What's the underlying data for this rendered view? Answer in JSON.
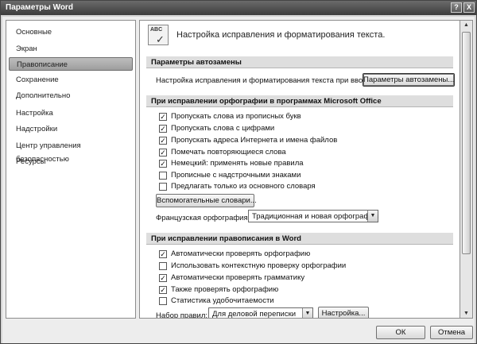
{
  "window": {
    "title": "Параметры Word",
    "help_label": "?",
    "close_label": "X"
  },
  "sidebar": {
    "items": [
      {
        "label": "Основные"
      },
      {
        "label": "Экран"
      },
      {
        "label": "Правописание",
        "selected": true
      },
      {
        "label": "Сохранение"
      },
      {
        "label": "Дополнительно"
      },
      {
        "label": "Настройка"
      },
      {
        "label": "Надстройки"
      },
      {
        "label": "Центр управления безопасностью"
      },
      {
        "label": "Ресурсы"
      }
    ]
  },
  "main": {
    "header_icon_text": "ABC",
    "header_icon_check": "✓",
    "header_title": "Настройка исправления и форматирования текста.",
    "autocorrect": {
      "section_title": "Параметры автозамены",
      "description": "Настройка исправления и форматирования текста при вводе:",
      "button_label": "Параметры автозамены..."
    },
    "office_spelling": {
      "section_title": "При исправлении орфографии в программах Microsoft Office",
      "checkboxes": [
        {
          "label": "Пропускать слова из прописных букв",
          "checked": true
        },
        {
          "label": "Пропускать слова с цифрами",
          "checked": true
        },
        {
          "label": "Пропускать адреса Интернета и имена файлов",
          "checked": true
        },
        {
          "label": "Помечать повторяющиеся слова",
          "checked": true
        },
        {
          "label": "Немецкий: применять новые правила",
          "checked": true
        },
        {
          "label": "Прописные с надстрочными знаками",
          "checked": false
        },
        {
          "label": "Предлагать только из основного словаря",
          "checked": false
        }
      ],
      "dictionaries_button": "Вспомогательные словари...",
      "french_label": "Французская орфография:",
      "french_value": "Традиционная и новая орфография"
    },
    "word_spelling": {
      "section_title": "При исправлении правописания в Word",
      "checkboxes": [
        {
          "label": "Автоматически проверять орфографию",
          "checked": true
        },
        {
          "label": "Использовать контекстную проверку орфографии",
          "checked": false
        },
        {
          "label": "Автоматически проверять грамматику",
          "checked": true
        },
        {
          "label": "Также проверять орфографию",
          "checked": true
        },
        {
          "label": "Статистика удобочитаемости",
          "checked": false
        }
      ],
      "ruleset_label": "Набор правил:",
      "ruleset_value": "Для деловой переписки",
      "settings_button": "Настройка..."
    }
  },
  "footer": {
    "ok_label": "ОК",
    "cancel_label": "Отмена"
  },
  "icons": {
    "dropdown_arrow": "▼",
    "scroll_up": "▲",
    "scroll_down": "▼",
    "check_mark": "✓"
  }
}
